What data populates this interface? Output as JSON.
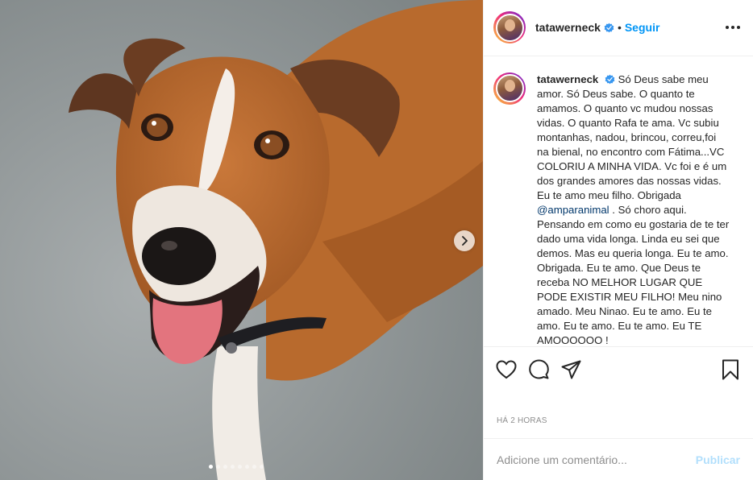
{
  "post": {
    "carousel": {
      "total_slides": 8,
      "active_slide": 1
    }
  },
  "header": {
    "username": "tatawerneck",
    "separator": "•",
    "follow_label": "Seguir"
  },
  "caption": {
    "username": "tatawerneck",
    "text_before_mention": "Só Deus sabe meu amor. Só Deus sabe. O quanto te amamos. O quanto vc mudou nossas vidas. O quanto Rafa te ama. Vc subiu montanhas, nadou, brincou, correu,foi na bienal, no encontro com Fátima...VC COLORIU A MINHA VIDA. Vc foi e é um dos grandes amores das nossas vidas. Eu te amo meu filho. Obrigada",
    "mention": "@amparanimal",
    "text_after_mention": ". Só choro aqui. Pensando em como eu gostaria de te ter dado uma vida longa. Linda eu sei que demos. Mas eu queria longa. Eu te amo. Obrigada. Eu te amo. Que Deus te receba NO MELHOR LUGAR QUE PODE EXISTIR MEU FILHO! Meu nino amado. Meu Ninao. Eu te amo. Eu te amo. Eu te amo. Eu te amo. Eu TE AMOOOOOO !"
  },
  "timestamp": "HÁ 2 HORAS",
  "comment": {
    "placeholder": "Adicione um comentário...",
    "publish_label": "Publicar"
  },
  "icons": {
    "verified": "verified-badge-icon",
    "more": "more-options-icon",
    "like": "heart-icon",
    "comment": "comment-bubble-icon",
    "share": "paper-plane-icon",
    "save": "bookmark-icon",
    "next": "chevron-right-icon"
  },
  "colors": {
    "accent_blue": "#0095f6",
    "publish_disabled": "#b2dffc",
    "secondary_text": "#8e8e8e",
    "mention": "#00376b"
  }
}
